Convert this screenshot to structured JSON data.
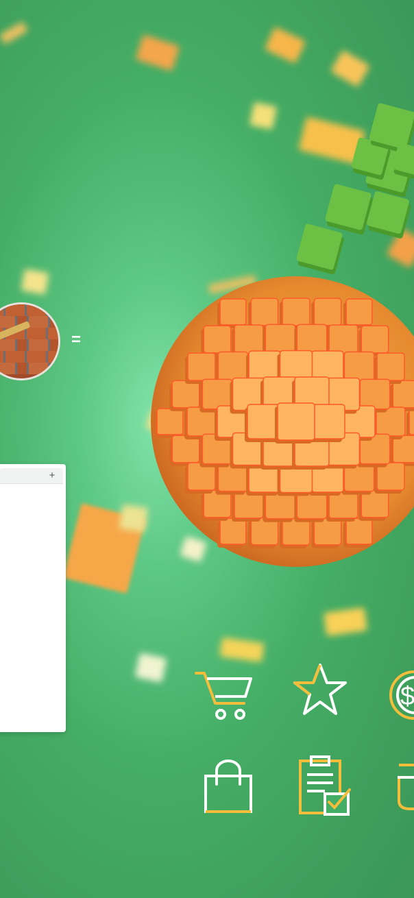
{
  "equation": {
    "operator": "="
  },
  "panel": {
    "add_label": "+"
  },
  "icons": [
    "shopping-cart-icon",
    "star-icon",
    "coin-dollar-icon",
    "shopping-bag-icon",
    "clipboard-checklist-icon",
    "bucket-icon"
  ],
  "colors": {
    "background": "#45ae66",
    "accent_yellow": "#f5bd3c",
    "icon_white": "#ffffff",
    "cube_orange": "#f6a24a",
    "cube_green": "#6cc043"
  }
}
